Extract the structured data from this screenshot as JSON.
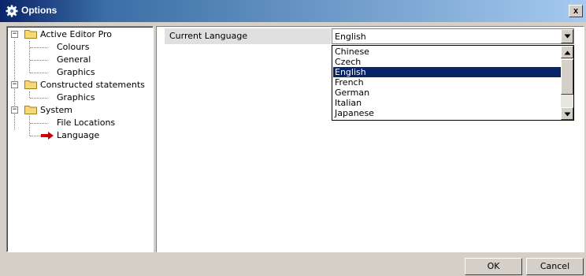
{
  "window": {
    "title": "Options",
    "close_label": "x"
  },
  "tree": {
    "items": [
      {
        "label": "Active Editor Pro",
        "expander": "−"
      },
      {
        "label": "Colours"
      },
      {
        "label": "General"
      },
      {
        "label": "Graphics"
      },
      {
        "label": "Constructed statements",
        "expander": "−"
      },
      {
        "label": "Graphics"
      },
      {
        "label": "System",
        "expander": "−"
      },
      {
        "label": "File Locations"
      },
      {
        "label": "Language",
        "selected": true
      }
    ]
  },
  "settings": {
    "current_language_label": "Current Language",
    "current_language_value": "English",
    "language_options": [
      "Chinese",
      "Czech",
      "English",
      "French",
      "German",
      "Italian",
      "Japanese"
    ],
    "highlighted_option": "English"
  },
  "buttons": {
    "ok": "OK",
    "cancel": "Cancel"
  },
  "colors": {
    "selection": "#0a246a",
    "titlebar_start": "#0a246a",
    "titlebar_end": "#a6caf0",
    "arrow": "#cc0000",
    "folder": "#f3d97a"
  }
}
